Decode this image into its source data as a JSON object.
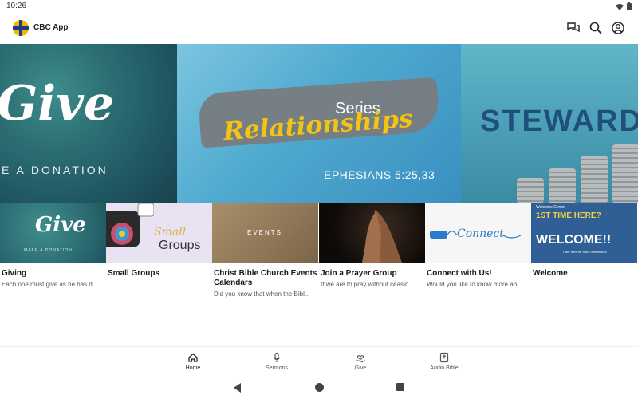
{
  "status_bar": {
    "time": "10:26"
  },
  "app_bar": {
    "title": "CBC App"
  },
  "carousel": {
    "slides": [
      {
        "headline": "Give",
        "subtitle": "E A DONATION"
      },
      {
        "label": "Series",
        "headline": "Relationships",
        "verse": "EPHESIANS 5:25,33"
      },
      {
        "headline": "STEWARD"
      }
    ],
    "active_index": 0,
    "dot_count": 4
  },
  "cards": [
    {
      "title": "Giving",
      "description": "Each one must give as he has d...",
      "thumb_text": "Give",
      "thumb_sub": "MAKE A DONATION"
    },
    {
      "title": "Small Groups",
      "description": "",
      "thumb_text": "Small",
      "thumb_sub": "Groups"
    },
    {
      "title": "Christ Bible Church Events Calendars",
      "description": "Did you know that when the Bibl...",
      "thumb_text": "EVENTS"
    },
    {
      "title": "Join a Prayer Group",
      "description": "If we are to pray without ceasin..."
    },
    {
      "title": "Connect with Us!",
      "description": "Would you like to know more ab...",
      "thumb_text": "Connect"
    },
    {
      "title": "Welcome",
      "description": "",
      "thumb_l1": "Welcome Center",
      "thumb_l2": "1ST TIME HERE?",
      "thumb_l3": "WELCOME!!",
      "thumb_l4": "Click here for more information"
    }
  ],
  "bottom_nav": [
    {
      "label": "Home",
      "icon": "home-icon",
      "active": true
    },
    {
      "label": "Sermons",
      "icon": "microphone-icon",
      "active": false
    },
    {
      "label": "Give",
      "icon": "giving-hand-icon",
      "active": false
    },
    {
      "label": "Audio Bible",
      "icon": "bible-icon",
      "active": false
    }
  ]
}
